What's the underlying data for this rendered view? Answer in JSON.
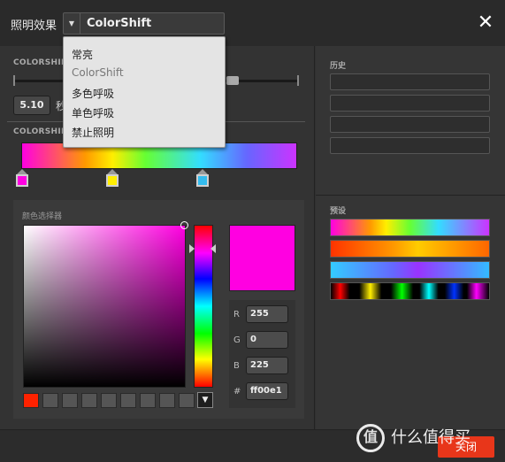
{
  "header": {
    "title": "照明效果",
    "mode_value": "ColorShift",
    "close_glyph": "✕",
    "arrow_glyph": "▼"
  },
  "dropdown": {
    "items": [
      {
        "label": "常亮",
        "selected": false
      },
      {
        "label": "ColorShift",
        "selected": true
      },
      {
        "label": "多色呼吸",
        "selected": false
      },
      {
        "label": "单色呼吸",
        "selected": false
      },
      {
        "label": "禁止照明",
        "selected": false
      }
    ]
  },
  "speed": {
    "section_label": "COLORSHIFT",
    "value": "5.10",
    "unit": "秒"
  },
  "gradient": {
    "section_label": "COLORSHIFT",
    "stops": [
      {
        "color": "#ff00e1"
      },
      {
        "color": "#ffee00"
      },
      {
        "color": "#33bbee"
      }
    ]
  },
  "picker": {
    "title": "颜色选择器",
    "current_color": "#ff00e1",
    "r_label": "R",
    "r": "255",
    "g_label": "G",
    "g": "0",
    "b_label": "B",
    "b": "225",
    "hex_label": "#",
    "hex": "ff00e1",
    "swatches": [
      "#ff2200",
      "#555555",
      "#555555",
      "#555555",
      "#555555",
      "#555555",
      "#555555",
      "#555555",
      "#555555"
    ],
    "more_glyph": "▼"
  },
  "history": {
    "label": "历史",
    "slots": 4
  },
  "presets": {
    "label": "预设",
    "items": [
      {
        "name": "preset-rainbow"
      },
      {
        "name": "preset-fire"
      },
      {
        "name": "preset-aqua"
      },
      {
        "name": "preset-spectrum-blocks"
      }
    ]
  },
  "footer": {
    "ok_label": "关闭",
    "watermark": "什么值得买",
    "watermark_logo": "值"
  },
  "colors": {
    "accent": "#e8361a",
    "background": "#303030",
    "panel": "#333333"
  }
}
